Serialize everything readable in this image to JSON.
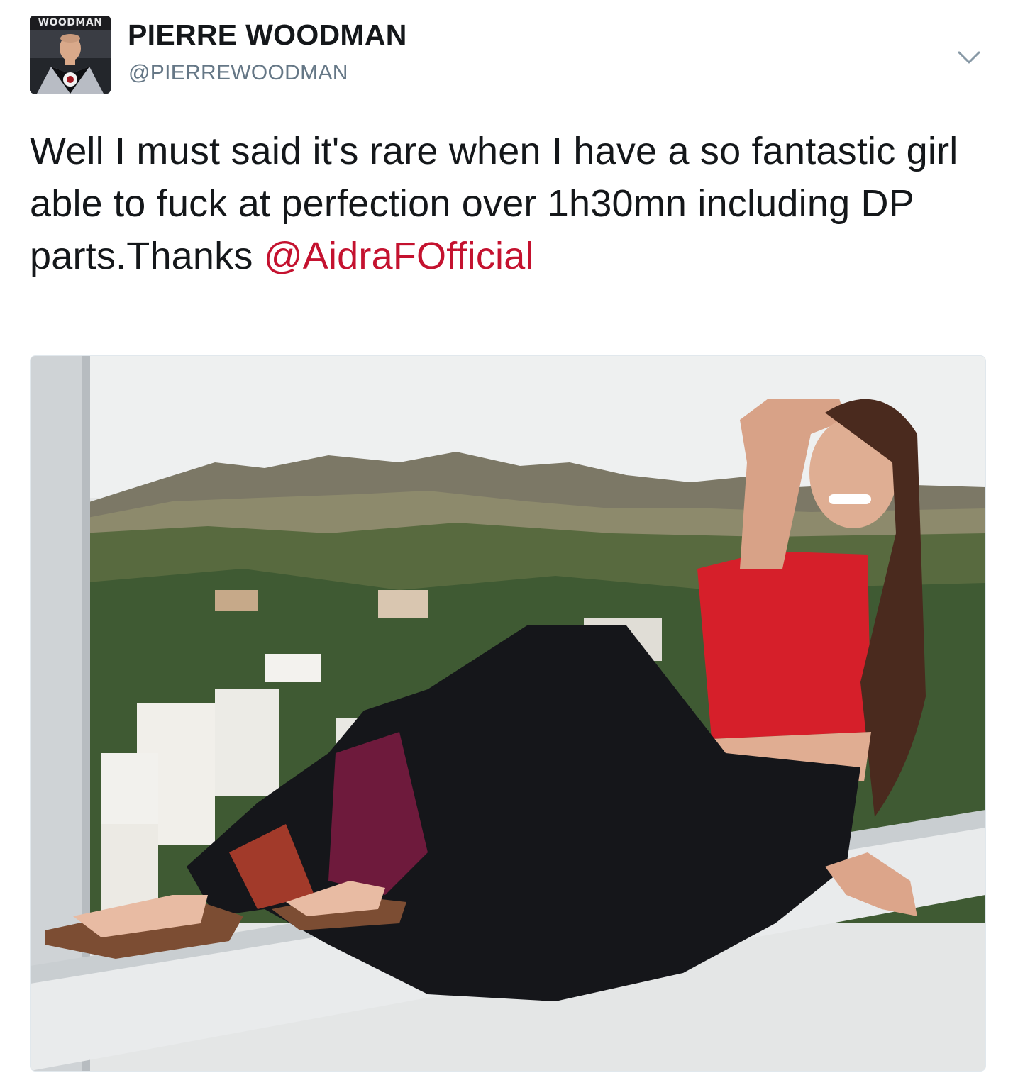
{
  "tweet": {
    "author": {
      "avatar_label": "WOODMAN",
      "name": "PIERRE WOODMAN",
      "handle": "@PIERREWOODMAN"
    },
    "menu_icon": "chevron-down-icon",
    "text": "Well I must said it's rare when I have a so fantastic girl able to fuck at perfection over 1h30mn including DP parts.Thanks ",
    "mention": "@AidraFOfficial",
    "colors": {
      "text": "#14171a",
      "handle": "#657786",
      "mention": "#c4122f",
      "chevron": "#8899a6"
    }
  }
}
